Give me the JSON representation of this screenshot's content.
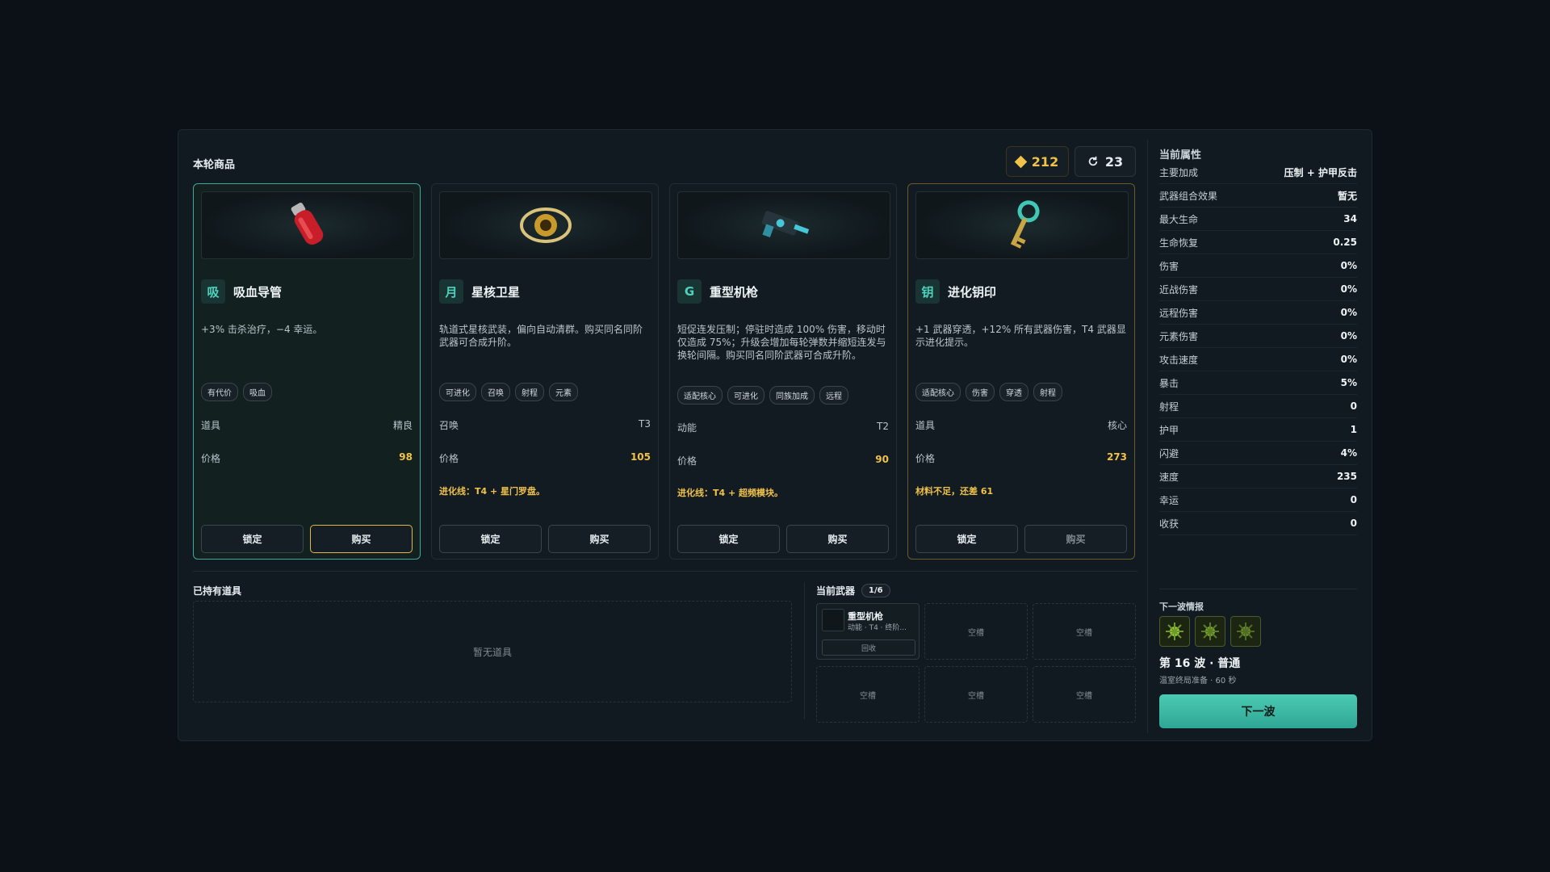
{
  "shop": {
    "title": "本轮商品",
    "gold": "212",
    "reroll_cost": "23",
    "cards": [
      {
        "glyph": "吸",
        "name": "吸血导管",
        "desc": "+3% 击杀治疗，−4 幸运。",
        "tags": [
          "有代价",
          "吸血"
        ],
        "category": "道具",
        "tier": "精良",
        "price_label": "价格",
        "price": "98",
        "note": "",
        "lock": "锁定",
        "buy": "购买"
      },
      {
        "glyph": "月",
        "name": "星核卫星",
        "desc": "轨道式星核武装，偏向自动清群。购买同名同阶武器可合成升阶。",
        "tags": [
          "可进化",
          "召唤",
          "射程",
          "元素"
        ],
        "category": "召唤",
        "tier": "T3",
        "price_label": "价格",
        "price": "105",
        "note": "进化线：T4 + 星门罗盘。",
        "lock": "锁定",
        "buy": "购买"
      },
      {
        "glyph": "G",
        "name": "重型机枪",
        "desc": "短促连发压制；停驻时造成 100% 伤害，移动时仅造成 75%；升级会增加每轮弹数并缩短连发与换轮间隔。购买同名同阶武器可合成升阶。",
        "tags": [
          "适配核心",
          "可进化",
          "同族加成",
          "远程"
        ],
        "category": "动能",
        "tier": "T2",
        "price_label": "价格",
        "price": "90",
        "note": "进化线：T4 + 超频模块。",
        "lock": "锁定",
        "buy": "购买"
      },
      {
        "glyph": "钥",
        "name": "进化钥印",
        "desc": "+1 武器穿透，+12% 所有武器伤害，T4 武器显示进化提示。",
        "tags": [
          "适配核心",
          "伤害",
          "穿透",
          "射程"
        ],
        "category": "道具",
        "tier": "核心",
        "price_label": "价格",
        "price": "273",
        "note": "材料不足，还差 61",
        "lock": "锁定",
        "buy": "购买"
      }
    ]
  },
  "items": {
    "title": "已持有道具",
    "empty": "暂无道具"
  },
  "weapons": {
    "title": "当前武器",
    "count": "1/6",
    "slot1": {
      "name": "重型机枪",
      "sub": "动能 · T4 · 终阶...",
      "recycle": "回收"
    },
    "empty": "空槽"
  },
  "attributes": {
    "title": "当前属性",
    "rows": [
      {
        "k": "主要加成",
        "v": "压制 + 护甲反击"
      },
      {
        "k": "武器组合效果",
        "v": "暂无"
      },
      {
        "k": "最大生命",
        "v": "34"
      },
      {
        "k": "生命恢复",
        "v": "0.25"
      },
      {
        "k": "伤害",
        "v": "0%"
      },
      {
        "k": "近战伤害",
        "v": "0%"
      },
      {
        "k": "远程伤害",
        "v": "0%"
      },
      {
        "k": "元素伤害",
        "v": "0%"
      },
      {
        "k": "攻击速度",
        "v": "0%"
      },
      {
        "k": "暴击",
        "v": "5%"
      },
      {
        "k": "射程",
        "v": "0"
      },
      {
        "k": "护甲",
        "v": "1"
      },
      {
        "k": "闪避",
        "v": "4%"
      },
      {
        "k": "速度",
        "v": "235"
      },
      {
        "k": "幸运",
        "v": "0"
      },
      {
        "k": "收获",
        "v": "0"
      }
    ]
  },
  "next_wave": {
    "title": "下一波情报",
    "wave": "第 16 波 · 普通",
    "sub": "温室终局准备 · 60 秒",
    "button": "下一波"
  }
}
